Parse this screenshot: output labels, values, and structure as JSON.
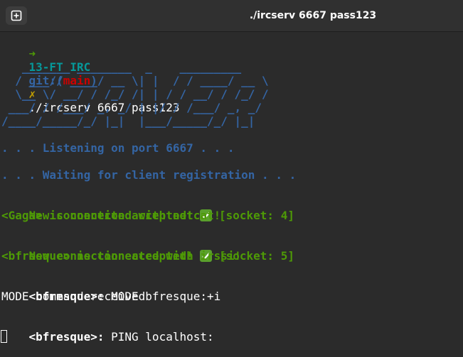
{
  "window": {
    "title": "./ircserv 6667 pass123",
    "new_tab_icon": "plus-square-icon"
  },
  "prompt": {
    "arrow": "➜",
    "dir": "13-FT_IRC",
    "git_label": "git:(",
    "branch": "main",
    "git_close": ")",
    "dirty_mark": "✗",
    "command": "./ircserv 6667 pass123"
  },
  "banner": {
    "lines": [
      "   _______ ________  _    _________ ",
      "  / ___// ____/ __ \\| |  / / ____/ __ \\",
      "  \\__ \\/ __/ / /_/ /| | / / __/ / /_/ /",
      " ___/ / /___/ _, _/ | |/ / /___/ _, _/ ",
      "/____/_____/_/ |_|  |___/_____/_/ |_|  "
    ]
  },
  "log": {
    "listening": ". . . Listening on port 6667 . . .",
    "waiting": ". . . Waiting for client registration . . .",
    "conn1_msg": "New connection accepted! ",
    "conn1_socket": " [socket: 4]",
    "conn1_client": "<Gaga> is connected with netcat!",
    "conn2_msg": "New connection accepted! ",
    "conn2_socket": " [socket: 5]",
    "conn2_client": "<bfresque> is connected with irssi!",
    "cmd1_user": "<bfresque>:",
    "cmd1_text": " MODE bfresque:+i",
    "cmd1_reply": "MODE command received",
    "cmd2_user": "<bfresque>:",
    "cmd2_text": " PING localhost:"
  },
  "colors": {
    "background": "#2b2b2b",
    "green": "#4e9a06",
    "blue": "#3465a4",
    "cyan": "#06989a",
    "red": "#cc0000",
    "yellow": "#c4a000"
  }
}
